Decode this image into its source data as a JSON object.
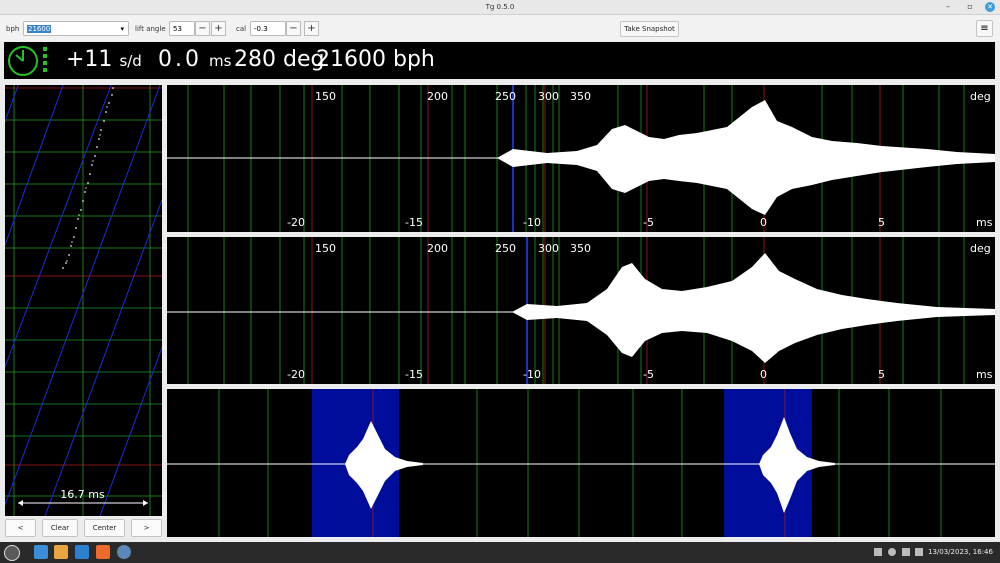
{
  "window": {
    "title": "Tg 0.5.0",
    "minimize_glyph": "–",
    "maximize_glyph": "▫",
    "close_glyph": "✕"
  },
  "toolbar": {
    "bph_label": "bph",
    "bph_value": "21600",
    "bph_arrow": "▾",
    "lift_label": "lift angle",
    "lift_value": "53",
    "cal_label": "cal",
    "cal_value": "-0.3",
    "minus": "−",
    "plus": "+",
    "snapshot_label": "Take Snapshot",
    "menu_glyph": "≡"
  },
  "status": {
    "rate_value": "+11",
    "rate_unit": "s/d",
    "beat_error_value": "0.0",
    "beat_error_unit": "ms",
    "amplitude_value": "280",
    "amplitude_unit": "deg",
    "bph_value": "21600",
    "bph_unit": "bph",
    "signal_color": "#16c716"
  },
  "paperstrip": {
    "span_label": "16.7 ms",
    "clear_label": "Clear",
    "center_label": "Center",
    "left_label": "<",
    "right_label": ">"
  },
  "scopes": {
    "deg_ticks": [
      "150",
      "200",
      "250",
      "300",
      "350"
    ],
    "deg_unit": "deg",
    "ms_ticks": [
      "-20",
      "-15",
      "-10",
      "-5",
      "0",
      "5"
    ],
    "ms_unit": "ms"
  },
  "taskbar": {
    "clock": "13/03/2023, 16:46"
  },
  "colors": {
    "waveform": "#ffffff",
    "grid_green": "#1f9a1f",
    "grid_red": "#a02020",
    "marker_blue": "#2540ff",
    "highlight_blue": "#000c9a",
    "clock_green": "#22c322"
  }
}
